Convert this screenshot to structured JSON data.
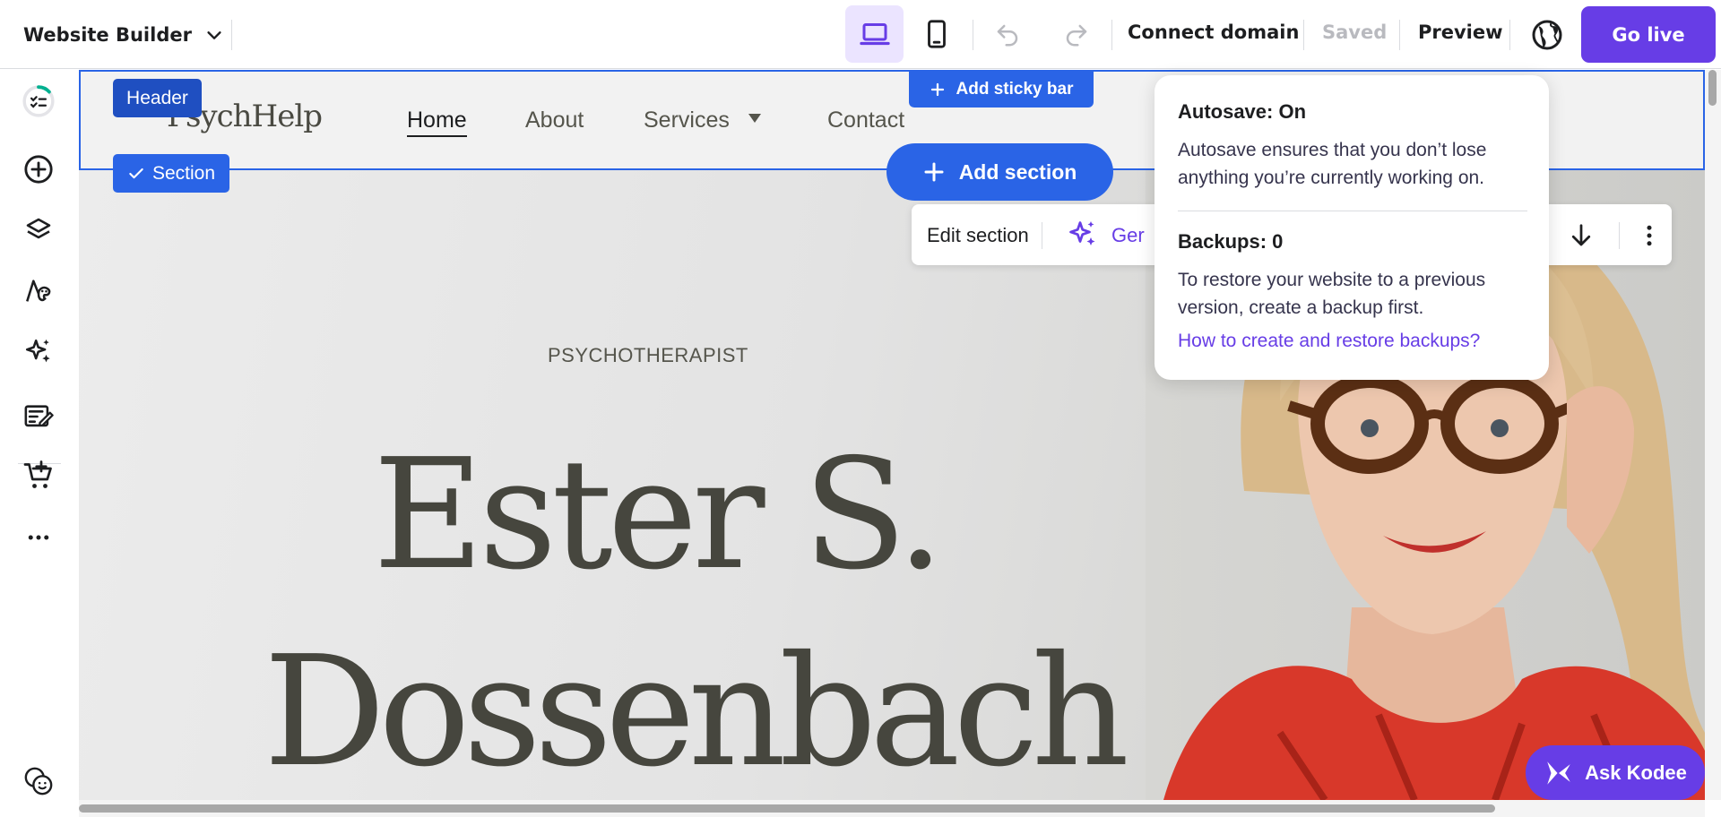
{
  "topbar": {
    "title": "Website Builder",
    "connect_domain": "Connect domain",
    "saved": "Saved",
    "preview": "Preview",
    "go_live": "Go live"
  },
  "canvas": {
    "sticky_bar": "Add sticky bar",
    "header_tag": "Header",
    "section_tag": "Section",
    "add_section": "Add section",
    "edit_section": "Edit section",
    "generate_partial": "Ger"
  },
  "site": {
    "logo": "PsychHelp",
    "nav": [
      "Home",
      "About",
      "Services",
      "Contact"
    ],
    "hero_subtitle": "PSYCHOTHERAPIST",
    "hero_name_line1": "Ester S.",
    "hero_name_line2": "Dossenbach"
  },
  "popover": {
    "autosave_title": "Autosave: On",
    "autosave_text": "Autosave ensures that you don’t lose anything you’re currently working on.",
    "backups_title": "Backups: 0",
    "backups_text": "To restore your website to a previous version, create a backup first.",
    "backups_link": "How to create and restore backups?"
  },
  "assistant": {
    "label": "Ask Kodee"
  },
  "colors": {
    "accent": "#673de6",
    "selection": "#2a64e6"
  }
}
